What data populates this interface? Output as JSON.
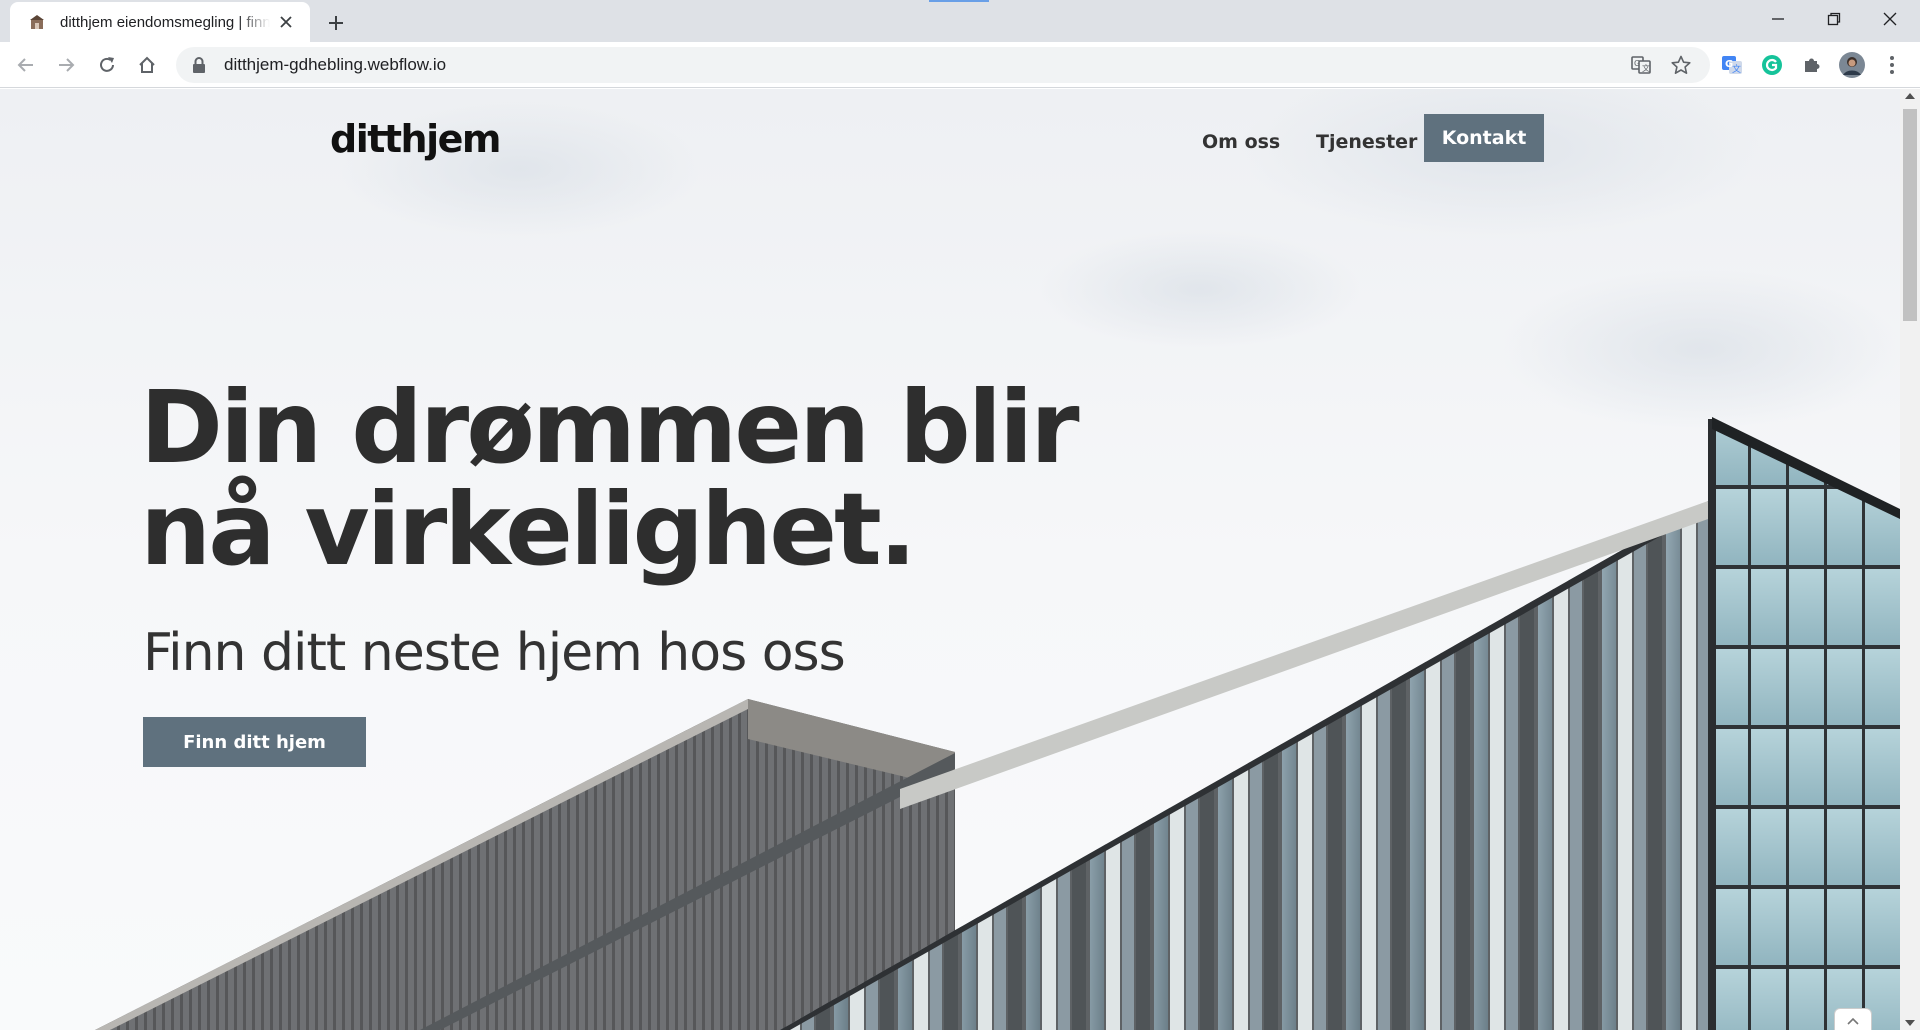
{
  "browser": {
    "tab": {
      "title": "ditthjem eiendomsmegling | finn ditt neste hjem",
      "favicon": "house-favicon-icon"
    },
    "new_tab_icon": "plus-icon",
    "window_controls": [
      "minimize-icon",
      "restore-icon",
      "close-icon"
    ],
    "nav_icons": [
      "back-arrow-icon",
      "forward-arrow-icon",
      "reload-icon",
      "home-icon"
    ],
    "address": {
      "url": "ditthjem-gdhebling.webflow.io",
      "secure_icon": "lock-icon"
    },
    "omnibox_icons": [
      "translate-icon",
      "bookmark-star-icon"
    ],
    "extension_icons": [
      "google-translate-extension-icon",
      "grammarly-icon",
      "extensions-puzzle-icon",
      "profile-avatar",
      "menu-kebab-icon"
    ],
    "accent_color": "#1a73e8"
  },
  "site": {
    "logo": "ditthjem",
    "nav": {
      "about": "Om oss",
      "services": "Tjenester",
      "contact": "Kontakt"
    },
    "hero": {
      "heading_line1": "Din drømmen blir",
      "heading_line2": "nå virkelighet.",
      "subheading": "Finn ditt neste hjem hos oss",
      "cta": "Finn ditt hjem"
    },
    "colors": {
      "button": "#5f717e",
      "heading": "#2e2e2e",
      "sky": "#f5f6f8"
    },
    "scroll_to_top_icon": "chevron-up-icon"
  }
}
